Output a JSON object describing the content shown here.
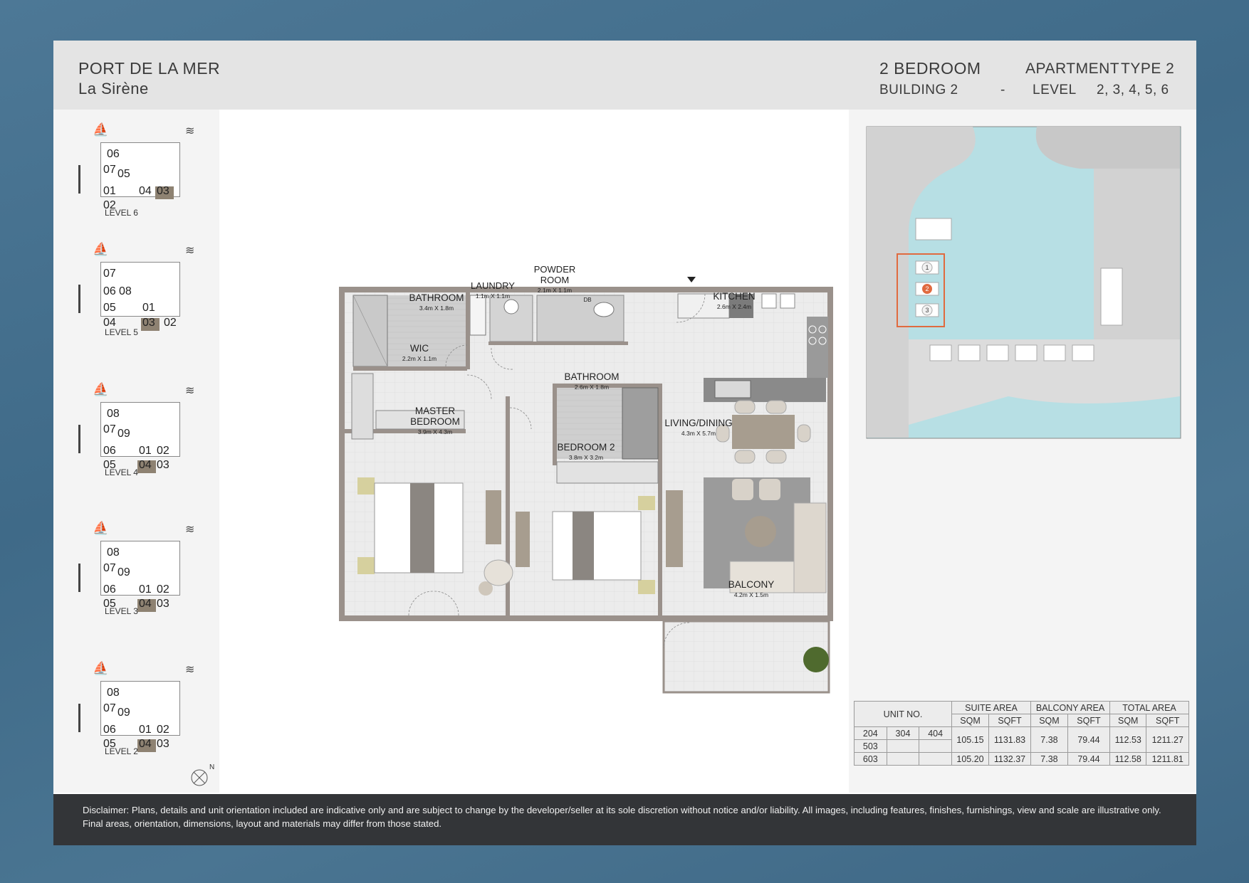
{
  "header": {
    "project": "PORT DE LA MER",
    "building_name": "La Sirène",
    "bedrooms": "2 BEDROOM",
    "apartment": "APARTMENT",
    "type": "TYPE 2",
    "building": "BUILDING 2",
    "dash": "-",
    "level_label": "LEVEL",
    "levels": "2, 3, 4, 5, 6"
  },
  "key_plans": [
    {
      "label": "LEVEL 6",
      "units": [
        "06",
        "07",
        "05",
        "01",
        "04",
        "03",
        "02"
      ],
      "highlight": "03"
    },
    {
      "label": "LEVEL 5",
      "units": [
        "07",
        "06",
        "08",
        "05",
        "01",
        "04",
        "03",
        "02"
      ],
      "highlight": "03"
    },
    {
      "label": "LEVEL 4",
      "units": [
        "08",
        "07",
        "09",
        "06",
        "01",
        "02",
        "05",
        "04",
        "03"
      ],
      "highlight": "04"
    },
    {
      "label": "LEVEL 3",
      "units": [
        "08",
        "07",
        "09",
        "06",
        "01",
        "02",
        "05",
        "04",
        "03"
      ],
      "highlight": "04"
    },
    {
      "label": "LEVEL 2",
      "units": [
        "08",
        "07",
        "09",
        "06",
        "01",
        "02",
        "05",
        "04",
        "03"
      ],
      "highlight": "04"
    }
  ],
  "compass": "N",
  "rooms": {
    "bathroom1": {
      "name": "BATHROOM",
      "dim": "3.4m X 1.8m"
    },
    "laundry": {
      "name": "LAUNDRY",
      "dim": "1.1m X 1.1m"
    },
    "powder": {
      "name": "POWDER ROOM",
      "dim": "2.1m X 1.1m"
    },
    "db": "DB",
    "kitchen": {
      "name": "KITCHEN",
      "dim": "2.6m X 2.4m"
    },
    "wic": {
      "name": "WIC",
      "dim": "2.2m X 1.1m"
    },
    "bathroom2": {
      "name": "BATHROOM",
      "dim": "2.6m X 1.8m"
    },
    "master": {
      "name": "MASTER BEDROOM",
      "dim": "3.9m X 4.3m"
    },
    "bedroom2": {
      "name": "BEDROOM 2",
      "dim": "3.8m X 3.2m"
    },
    "living": {
      "name": "LIVING/DINING",
      "dim": "4.3m X 5.7m"
    },
    "balcony": {
      "name": "BALCONY",
      "dim": "4.2m X 1.5m"
    }
  },
  "site_plan": {
    "buildings": [
      "1",
      "2",
      "3"
    ],
    "highlight": "2"
  },
  "area_table": {
    "headers": {
      "unit": "UNIT NO.",
      "suite": "SUITE AREA",
      "balcony": "BALCONY AREA",
      "total": "TOTAL AREA",
      "sqm": "SQM",
      "sqft": "SQFT"
    },
    "rows": [
      {
        "units": [
          "204",
          "304",
          "404"
        ],
        "suite_sqm": "105.15",
        "suite_sqft": "1131.83",
        "bal_sqm": "7.38",
        "bal_sqft": "79.44",
        "tot_sqm": "112.53",
        "tot_sqft": "1211.27"
      },
      {
        "units": [
          "503"
        ]
      },
      {
        "units": [
          "603"
        ],
        "suite_sqm": "105.20",
        "suite_sqft": "1132.37",
        "bal_sqm": "7.38",
        "bal_sqft": "79.44",
        "tot_sqm": "112.58",
        "tot_sqft": "1211.81"
      }
    ]
  },
  "disclaimer": "Disclaimer: Plans, details and unit orientation included are indicative only and are subject to change by the developer/seller at its sole discretion without notice and/or liability. All images, including features, finishes, furnishings, view and scale are illustrative only. Final areas, orientation, dimensions, layout and materials may differ from those stated."
}
